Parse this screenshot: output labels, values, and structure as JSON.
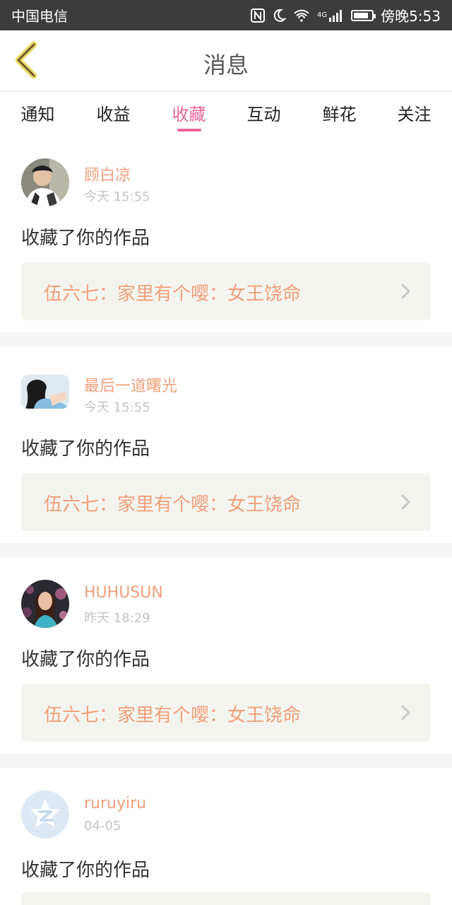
{
  "status_bar": {
    "carrier": "中国电信",
    "time": "傍晚5:53",
    "network": "4G"
  },
  "header": {
    "title": "消息",
    "back_icon": "chevron-left-icon"
  },
  "tabs": [
    {
      "label": "通知",
      "active": false
    },
    {
      "label": "收益",
      "active": false
    },
    {
      "label": "收藏",
      "active": true
    },
    {
      "label": "互动",
      "active": false
    },
    {
      "label": "鲜花",
      "active": false
    },
    {
      "label": "关注",
      "active": false
    }
  ],
  "notifications": [
    {
      "user": "顾白凉",
      "time": "今天 15:55",
      "action": "收藏了你的作品",
      "work": "伍六七：家里有个嘤：女王饶命"
    },
    {
      "user": "最后一道曙光",
      "time": "今天 15:55",
      "action": "收藏了你的作品",
      "work": "伍六七：家里有个嘤：女王饶命"
    },
    {
      "user": "HUHUSUN",
      "time": "昨天 18:29",
      "action": "收藏了你的作品",
      "work": "伍六七：家里有个嘤：女王饶命"
    },
    {
      "user": "ruruyiru",
      "time": "04-05",
      "action": "收藏了你的作品",
      "work": ""
    }
  ],
  "colors": {
    "accent": "#e8669c",
    "username": "#f0a07b",
    "work_link_bg": "#f4f4ef",
    "status_bar_bg": "#3c3c3c"
  }
}
